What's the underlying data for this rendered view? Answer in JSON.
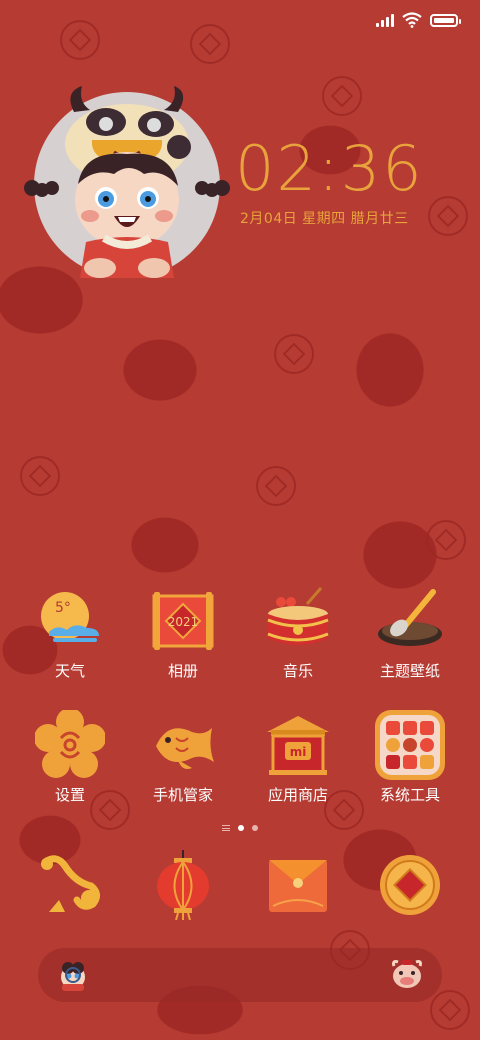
{
  "status_bar": {
    "signal_bars": 4,
    "battery_level": 1.0
  },
  "clock": {
    "time": "02:36",
    "date": "2月04日 星期四 腊月廿三"
  },
  "apps": [
    {
      "label": "天气",
      "icon": "weather-icon",
      "badge": "5°"
    },
    {
      "label": "相册",
      "icon": "album-icon",
      "badge": "2021"
    },
    {
      "label": "音乐",
      "icon": "drum-icon"
    },
    {
      "label": "主题壁纸",
      "icon": "brush-inkstone-icon"
    },
    {
      "label": "设置",
      "icon": "plum-flower-gear-icon"
    },
    {
      "label": "手机管家",
      "icon": "koi-fish-icon"
    },
    {
      "label": "应用商店",
      "icon": "mi-store-gate-icon",
      "badge": "mi"
    },
    {
      "label": "系统工具",
      "icon": "tools-folder-icon"
    }
  ],
  "dock": [
    {
      "icon": "ruyi-knot-icon"
    },
    {
      "icon": "lantern-icon"
    },
    {
      "icon": "red-envelope-icon"
    },
    {
      "icon": "copper-coin-icon"
    }
  ],
  "page_indicator": {
    "pages": 2,
    "current": 1
  },
  "colors": {
    "accent": "#e8a33c",
    "background": "#b63b33"
  }
}
